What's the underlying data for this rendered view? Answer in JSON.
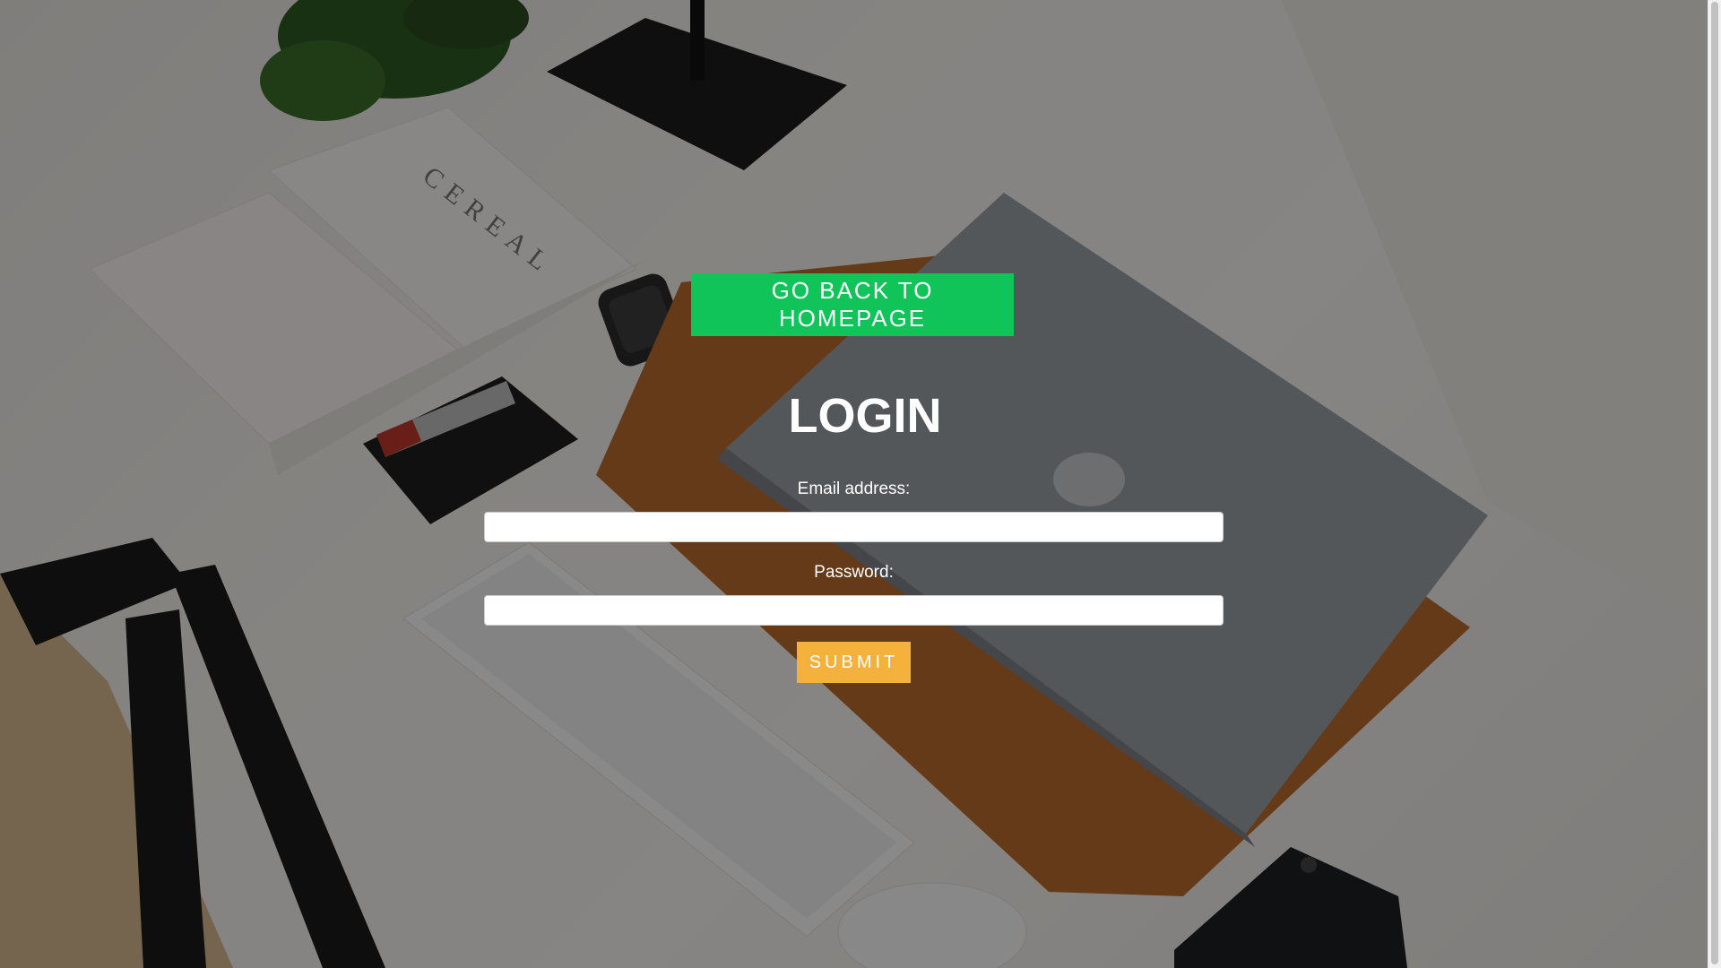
{
  "nav": {
    "home_button_label": "GO BACK TO HOMEPAGE"
  },
  "login": {
    "title": "LOGIN",
    "email_label": "Email address:",
    "email_value": "",
    "password_label": "Password:",
    "password_value": "",
    "submit_label": "SUBMIT"
  },
  "colors": {
    "home_button": "#10c45a",
    "submit_button": "#f4b13c",
    "text": "#ffffff",
    "overlay": "rgba(0,0,0,0.45)"
  },
  "background": {
    "scene_icons": [
      "plant",
      "lamp-base",
      "magazine",
      "notebook",
      "smartwatch",
      "card-wallet",
      "laptop",
      "leather-sleeve",
      "keyboard",
      "mouse",
      "smartphone",
      "desk-legs"
    ],
    "magazine_text": "CEREAL"
  }
}
